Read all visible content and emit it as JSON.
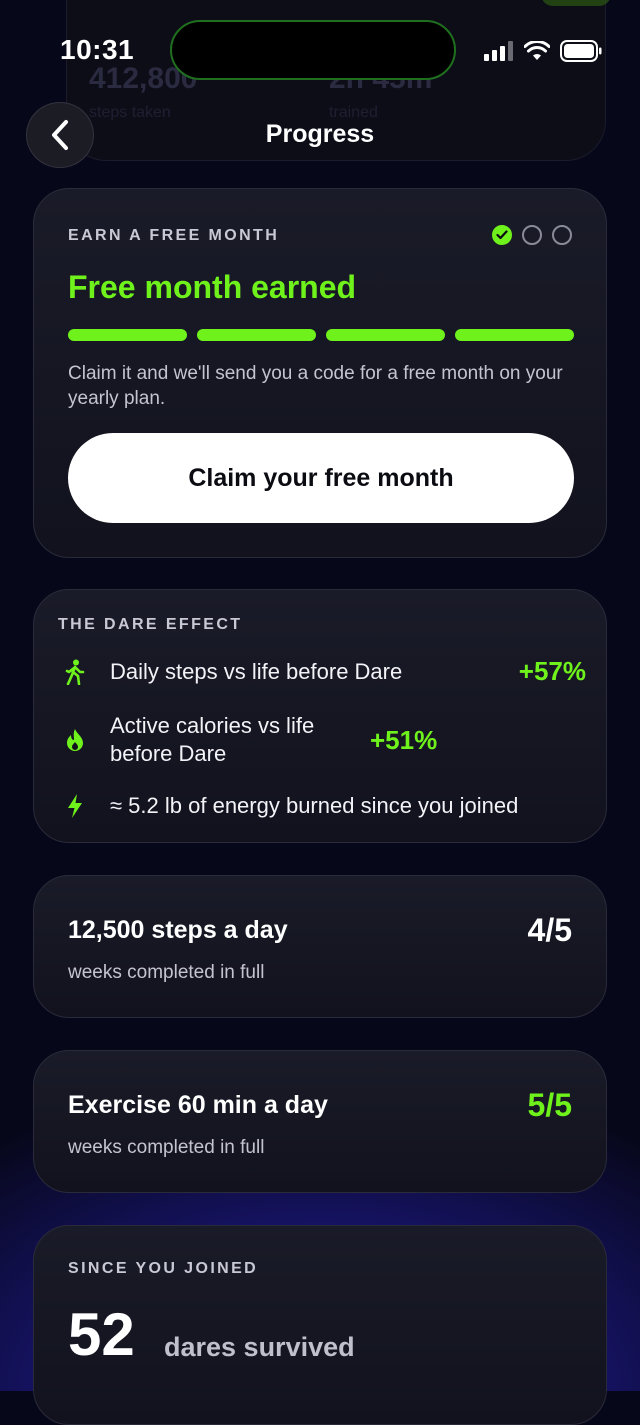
{
  "status_bar": {
    "time": "10:31"
  },
  "background_hint": {
    "number": "412,800",
    "sub": "steps taken",
    "number2": "2h 45m",
    "sub2": "trained"
  },
  "nav": {
    "title": "Progress"
  },
  "earn_card": {
    "eyebrow": "EARN A FREE MONTH",
    "progress_steps": [
      true,
      false,
      false
    ],
    "headline": "Free month earned",
    "progress_segments": 4,
    "description": "Claim it and we'll send you a code for a free month on your yearly plan.",
    "cta_label": "Claim your free month"
  },
  "dare_effect": {
    "eyebrow": "THE DARE EFFECT",
    "rows": [
      {
        "icon": "walking-icon",
        "label": "Daily steps vs life before Dare",
        "value": "+57%"
      },
      {
        "icon": "flame-icon",
        "label": "Active calories vs life before Dare",
        "value": "+51%"
      },
      {
        "icon": "lightning-icon",
        "label": "≈ 5.2 lb of energy burned since you joined",
        "value": ""
      }
    ]
  },
  "goals": [
    {
      "title": "12,500 steps a day",
      "subtitle": "weeks completed in full",
      "value": "4/5"
    },
    {
      "title": "Exercise 60 min a day",
      "subtitle": "weeks completed in full",
      "value": "5/5"
    }
  ],
  "since_joined": {
    "eyebrow": "SINCE YOU JOINED",
    "number": "52",
    "label": "dares survived"
  },
  "colors": {
    "accent": "#6ff21c",
    "background": "#07071a",
    "card": "#161724",
    "button": "#ffffff"
  }
}
